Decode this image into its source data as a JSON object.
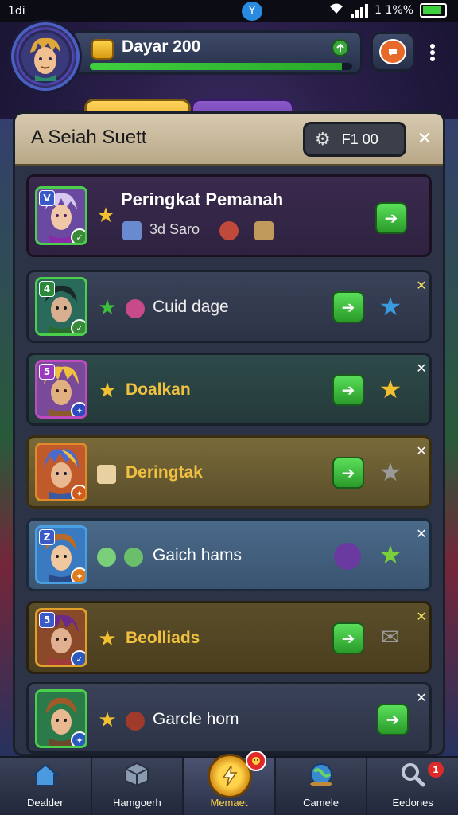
{
  "status_bar": {
    "time": "1di",
    "battery_text": "1 1%%",
    "battery_level": 0.9
  },
  "header": {
    "player_name": "Dayar 200",
    "xp_level": 0.96,
    "tabs": [
      {
        "label": "DGO",
        "active": true
      },
      {
        "label": "Daksiais",
        "active": false
      }
    ]
  },
  "panel": {
    "title": "A Seiah Suett",
    "filter_label": "F1 00"
  },
  "rows": [
    {
      "label": "Peringkat Pemanah",
      "sub_label": "3d Saro",
      "rank_badge": "V",
      "style": "purple"
    },
    {
      "label": "Cuid dage",
      "rank_badge": "4",
      "style": "slate"
    },
    {
      "label": "Doalkan",
      "rank_badge": "5",
      "style": "teal"
    },
    {
      "label": "Deringtak",
      "rank_badge": "",
      "style": "gold"
    },
    {
      "label": "Gaich hams",
      "rank_badge": "Z",
      "style": "blue"
    },
    {
      "label": "Beolliads",
      "rank_badge": "5",
      "style": "olive"
    },
    {
      "label": "Garcle hom",
      "rank_badge": "",
      "style": "slate"
    }
  ],
  "bottom_nav": [
    {
      "label": "Dealder",
      "icon": "home-icon"
    },
    {
      "label": "Hamgoerh",
      "icon": "cube-icon"
    },
    {
      "label": "Memaet",
      "icon": "lightning-coin-icon"
    },
    {
      "label": "Camele",
      "icon": "globe-icon"
    },
    {
      "label": "Eedones",
      "icon": "search-icon",
      "badge": "1"
    }
  ]
}
